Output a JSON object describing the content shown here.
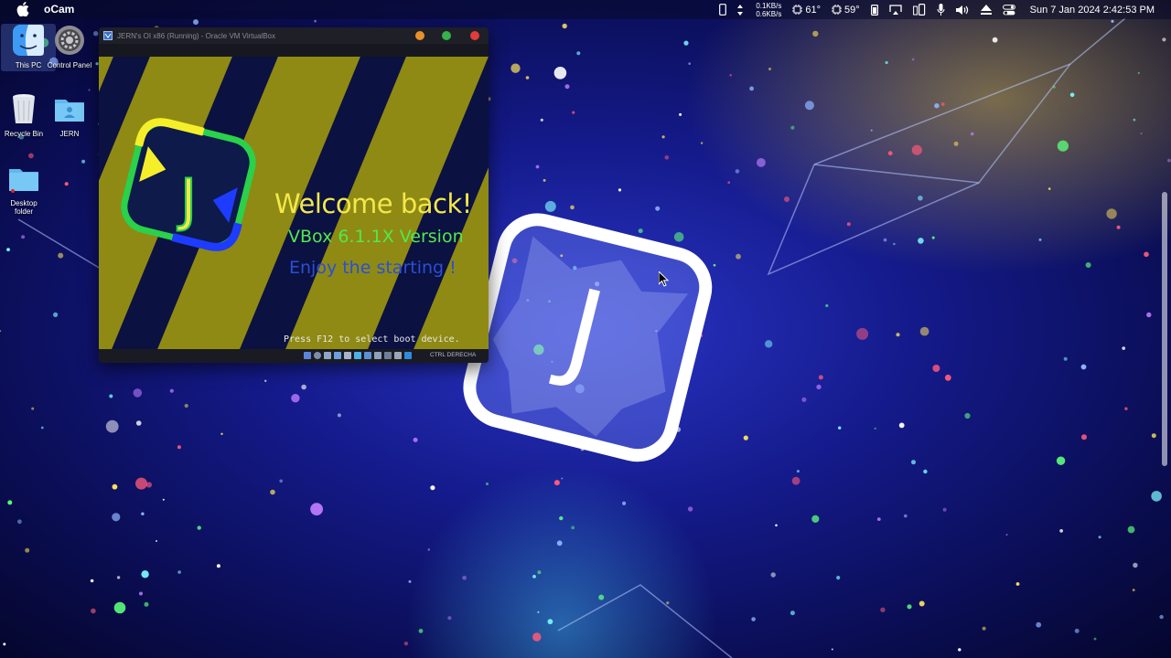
{
  "menubar": {
    "app_name": "oCam",
    "net_up": "0.1KB/s",
    "net_down": "0.6KB/s",
    "cpu_temp": "61°",
    "gpu_temp": "59°",
    "datetime": "Sun 7 Jan 2024 2:42:53 PM"
  },
  "desktop": {
    "icons": [
      {
        "label": "This PC"
      },
      {
        "label": "Control Panel"
      },
      {
        "label": "Recycle Bin"
      },
      {
        "label": "JERN"
      },
      {
        "label": "Desktop folder"
      }
    ]
  },
  "vm_window": {
    "title": "JERN's OI x86 (Running) - Oracle VM VirtualBox",
    "screen": {
      "logo_letter": "J",
      "welcome": "Welcome back!",
      "version": "VBox 6.1.1X Version",
      "enjoy": "Enjoy the starting !",
      "boot_message": "Press F12 to select boot device."
    },
    "status": {
      "host_key": "CTRL DERECHA"
    }
  },
  "wallpaper": {
    "logo_letter": "J"
  },
  "colors": {
    "welcome": "#f3e84a",
    "version": "#52e84c",
    "enjoy": "#2a4fd8",
    "stripe": "#8f8a14",
    "stripe_dark": "#0b1140"
  }
}
